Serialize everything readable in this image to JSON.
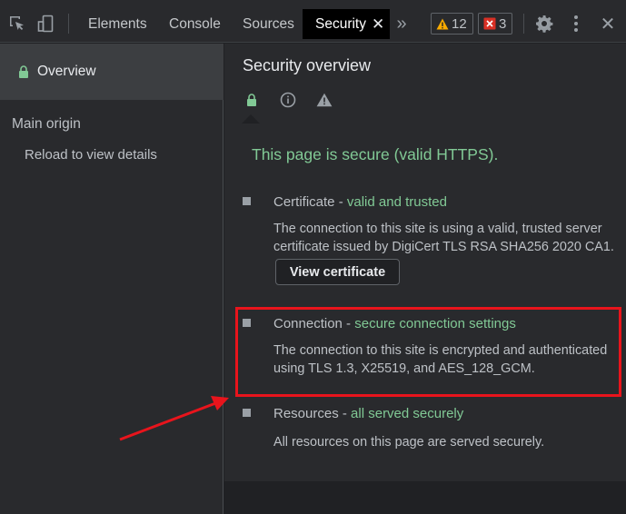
{
  "toolbar": {
    "tabs": [
      {
        "label": "Elements"
      },
      {
        "label": "Console"
      },
      {
        "label": "Sources"
      },
      {
        "label": "Security"
      }
    ],
    "active_tab": "Security",
    "warnings_count": "12",
    "errors_count": "3"
  },
  "sidebar": {
    "overview_label": "Overview",
    "main_origin_label": "Main origin",
    "reload_label": "Reload to view details"
  },
  "main": {
    "title": "Security overview",
    "secure_summary": "This page is secure (valid HTTPS).",
    "certificate": {
      "title": "Certificate",
      "separator": " - ",
      "status": "valid and trusted",
      "description": "The connection to this site is using a valid, trusted server certificate issued by DigiCert TLS RSA SHA256 2020 CA1.",
      "button_label": "View certificate"
    },
    "connection": {
      "title": "Connection",
      "separator": " - ",
      "status": "secure connection settings",
      "description": "The connection to this site is encrypted and authenticated using TLS 1.3, X25519, and AES_128_GCM."
    },
    "resources": {
      "title": "Resources",
      "separator": " - ",
      "status": "all served securely",
      "description": "All resources on this page are served securely."
    }
  },
  "colors": {
    "secure_green": "#81c995",
    "annotation_red": "#e8141c",
    "warning_yellow": "#f9ab00",
    "error_red": "#d93025"
  },
  "icons": {
    "inspect": "inspect-element-icon",
    "device": "device-toolbar-icon",
    "more_tabs": "chevron-double-right-icon",
    "settings": "gear-icon",
    "menu": "kebab-menu-icon",
    "close": "close-icon",
    "lock": "lock-icon",
    "info": "info-icon",
    "warning": "warning-icon"
  }
}
